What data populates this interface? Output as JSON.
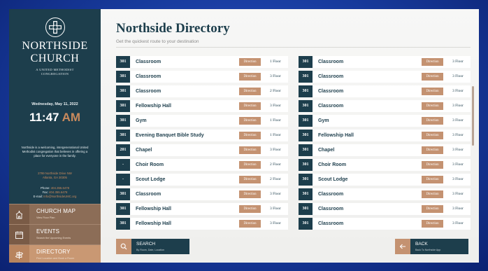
{
  "sidebar": {
    "church_name_line1": "NORTHSIDE",
    "church_name_line2": "CHURCH",
    "church_sub_line1": "A UNITED METHODIST",
    "church_sub_line2": "CONGREGATION",
    "date": "Wednesday, May 11, 2022",
    "time": "11:47",
    "ampm": "AM",
    "blurb": "Northside is a welcoming, intergenerational United Methodist congregation that believes in offering a place for everyone in the family.",
    "address_line1": "2799 Northside Drive NW",
    "address_line2": "Atlanta, GA 30305",
    "phone_label": "Phone:",
    "phone": "404.355.6478",
    "fax_label": "Fax:",
    "fax": "404.355.6478",
    "email_label": "E-mail:",
    "email": "Info@NorthsideUMC.org",
    "nav": [
      {
        "title": "CHURCH MAP",
        "sub": "View Floor Plan"
      },
      {
        "title": "EVENTS",
        "sub": "Search the Upcoming Events"
      },
      {
        "title": "DIRECTORY",
        "sub": "Find Location and Book a Room"
      }
    ]
  },
  "main": {
    "title": "Northside Directory",
    "subtitle": "Get the quickest route to your destination",
    "direction_label": "Direction",
    "left_rows": [
      {
        "num": "301",
        "name": "Classroom",
        "floor": "1 Floor"
      },
      {
        "num": "301",
        "name": "Classroom",
        "floor": "3 Floor"
      },
      {
        "num": "301",
        "name": "Classroom",
        "floor": "2 Floor"
      },
      {
        "num": "301",
        "name": "Fellowship Hall",
        "floor": "3 Floor"
      },
      {
        "num": "301",
        "name": "Gym",
        "floor": "1 Floor"
      },
      {
        "num": "301",
        "name": "Evening Banquet Bible Study",
        "floor": "1 Floor"
      },
      {
        "num": "201",
        "name": "Chapel",
        "floor": "3 Floor"
      },
      {
        "num": "-",
        "name": "Choir Room",
        "floor": "2 Floor"
      },
      {
        "num": "-",
        "name": "Scout Lodge",
        "floor": "2 Floor"
      },
      {
        "num": "301",
        "name": "Classroom",
        "floor": "3 Floor"
      },
      {
        "num": "301",
        "name": "Fellowship Hall",
        "floor": "3 Floor"
      },
      {
        "num": "301",
        "name": "Fellowship Hall",
        "floor": "3 Floor"
      }
    ],
    "right_rows": [
      {
        "num": "301",
        "name": "Classroom",
        "floor": "3 Floor"
      },
      {
        "num": "301",
        "name": "Classroom",
        "floor": "3 Floor"
      },
      {
        "num": "301",
        "name": "Classroom",
        "floor": "3 Floor"
      },
      {
        "num": "301",
        "name": "Classroom",
        "floor": "3 Floor"
      },
      {
        "num": "301",
        "name": "Gym",
        "floor": "3 Floor"
      },
      {
        "num": "301",
        "name": "Fellowship Hall",
        "floor": "3 Floor"
      },
      {
        "num": "301",
        "name": "Chapel",
        "floor": "3 Floor"
      },
      {
        "num": "301",
        "name": "Choir Room",
        "floor": "3 Floor"
      },
      {
        "num": "301",
        "name": "Scout Lodge",
        "floor": "3 Floor"
      },
      {
        "num": "301",
        "name": "Classroom",
        "floor": "3 Floor"
      },
      {
        "num": "301",
        "name": "Classroom",
        "floor": "3 Floor"
      },
      {
        "num": "301",
        "name": "Classroom",
        "floor": "3 Floor"
      }
    ],
    "search": {
      "title": "SEARCH",
      "sub": "By Room, Date, Location"
    },
    "back": {
      "title": "BACK",
      "sub": "Back To Northside App"
    }
  },
  "icons": {
    "logo": "cross-circle-icon",
    "map": "church-icon",
    "events": "calendar-icon",
    "directory": "signpost-icon",
    "search": "search-icon",
    "back": "arrow-left-icon"
  },
  "colors": {
    "navy": "#1d3e4c",
    "accent": "#c49271",
    "bezel": "#173a9c"
  }
}
